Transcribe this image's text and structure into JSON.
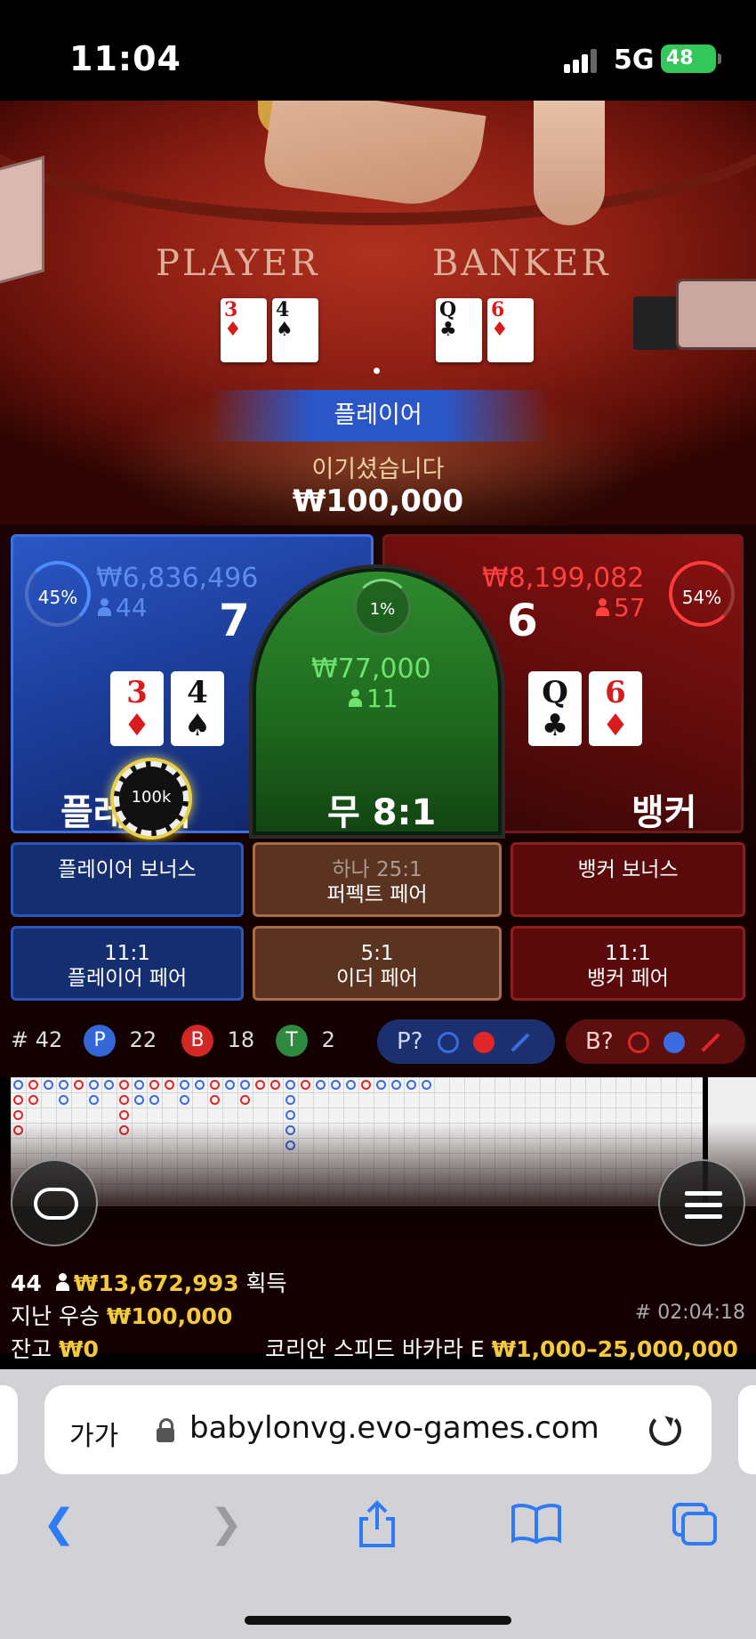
{
  "status_bar": {
    "time": "11:04",
    "network": "5G",
    "battery": "48"
  },
  "table": {
    "player_title": "PLAYER",
    "banker_title": "BANKER",
    "player_cards": [
      {
        "rank": "3",
        "suit": "♦"
      },
      {
        "rank": "4",
        "suit": "♠"
      }
    ],
    "banker_cards": [
      {
        "rank": "Q",
        "suit": "♣"
      },
      {
        "rank": "6",
        "suit": "♦"
      }
    ]
  },
  "result": {
    "winner": "플레이어",
    "message": "이기셨습니다",
    "amount": "₩100,000"
  },
  "player": {
    "percent": "45%",
    "total": "₩6,836,496",
    "bettors": "44",
    "score": "7",
    "name": "플레이어",
    "chip": "100k"
  },
  "tie": {
    "percent": "1%",
    "total": "₩77,000",
    "bettors": "11",
    "label": "무 8:1"
  },
  "banker": {
    "percent": "54%",
    "total": "₩8,199,082",
    "bettors": "57",
    "score": "6",
    "name": "뱅커"
  },
  "side_bets": {
    "player_bonus": "플레이어 보너스",
    "perfect_pair_top": "하나 25:1",
    "perfect_pair": "퍼펙트 페어",
    "banker_bonus": "뱅커 보너스",
    "player_pair_odds": "11:1",
    "player_pair": "플레이어 페어",
    "either_pair_odds": "5:1",
    "either_pair": "이더 페어",
    "banker_pair_odds": "11:1",
    "banker_pair": "뱅커 페어"
  },
  "stats": {
    "rounds_label": "# 42",
    "p_label": "P",
    "p_count": "22",
    "b_label": "B",
    "b_count": "18",
    "t_label": "T",
    "t_count": "2",
    "player_predict": "P?",
    "banker_predict": "B?"
  },
  "footer": {
    "players_online": "44",
    "total_won": "₩13,672,993",
    "won_label": "획득",
    "last_win_label": "지난 우승",
    "last_win": "₩100,000",
    "round_id": "# 02:04:18",
    "balance_label": "잔고",
    "balance": "₩0",
    "table_name": "코리안 스피드 바카라 E",
    "limits": "₩1,000–25,000,000"
  },
  "browser": {
    "aa": "가가",
    "url": "babylonvg.evo-games.com"
  },
  "colors": {
    "player": "#2b57c5",
    "banker": "#8a1212",
    "tie": "#2d8a2d",
    "gold": "#f3c93d",
    "browser_blue": "#2f7bf6"
  },
  "icons": [
    "signal-icon",
    "battery-icon",
    "person-icon",
    "chat-icon",
    "menu-icon",
    "lock-icon",
    "reload-icon",
    "back-icon",
    "forward-icon",
    "share-icon",
    "bookmarks-icon",
    "tabs-icon"
  ]
}
